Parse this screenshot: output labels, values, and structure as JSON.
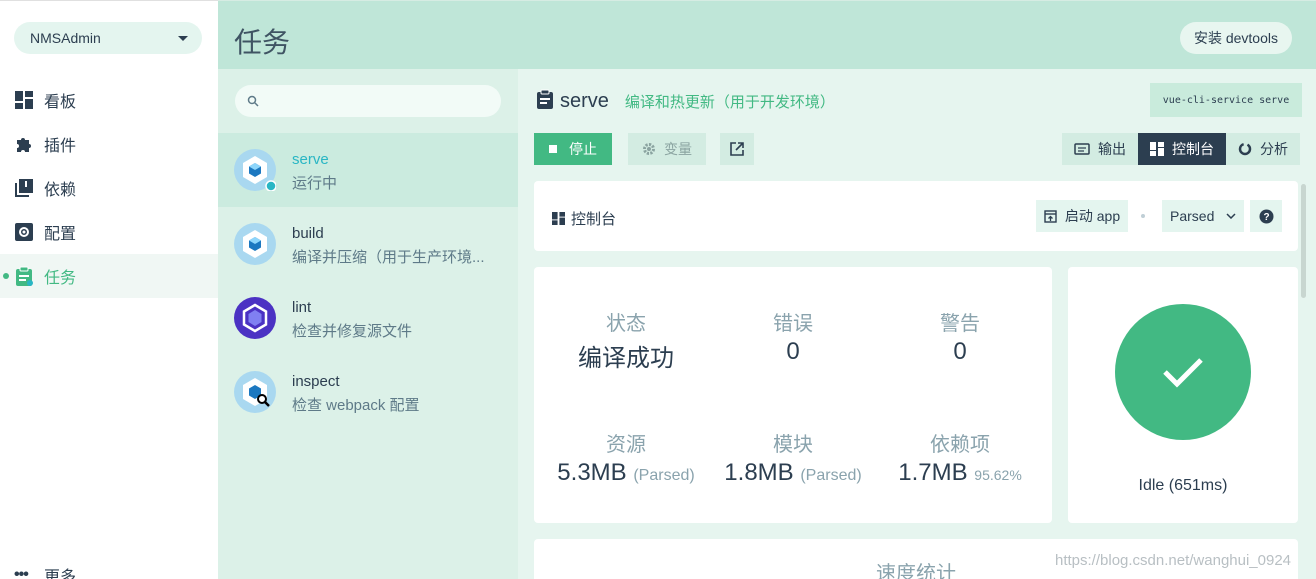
{
  "sidebar": {
    "project": "NMSAdmin",
    "items": [
      {
        "label": "看板",
        "icon": "dashboard-icon"
      },
      {
        "label": "插件",
        "icon": "puzzle-icon"
      },
      {
        "label": "依赖",
        "icon": "library-icon"
      },
      {
        "label": "配置",
        "icon": "gear-icon"
      },
      {
        "label": "任务",
        "icon": "clipboard-icon",
        "active": true
      }
    ],
    "more": "更多"
  },
  "header": {
    "title": "任务",
    "devtools_button": "安装 devtools"
  },
  "tasklist": {
    "search_placeholder": "",
    "tasks": [
      {
        "name": "serve",
        "desc": "运行中",
        "selected": true
      },
      {
        "name": "build",
        "desc": "编译并压缩（用于生产环境..."
      },
      {
        "name": "lint",
        "desc": "检查并修复源文件"
      },
      {
        "name": "inspect",
        "desc": "检查 webpack 配置"
      }
    ]
  },
  "main": {
    "task_name": "serve",
    "task_desc": "编译和热更新（用于开发环境）",
    "command": "vue-cli-service serve",
    "stop_button": "停止",
    "vars_button": "变量",
    "tabs": {
      "output": "输出",
      "console": "控制台",
      "analyze": "分析"
    },
    "dashboard": {
      "title": "控制台",
      "launch_app": "启动 app",
      "mode_select": "Parsed"
    },
    "stats": {
      "status_label": "状态",
      "status_value": "编译成功",
      "errors_label": "错误",
      "errors_value": "0",
      "warnings_label": "警告",
      "warnings_value": "0",
      "assets_label": "资源",
      "assets_value": "5.3MB",
      "assets_sub": "(Parsed)",
      "modules_label": "模块",
      "modules_value": "1.8MB",
      "modules_sub": "(Parsed)",
      "deps_label": "依赖项",
      "deps_value": "1.7MB",
      "deps_sub": "95.62%"
    },
    "status": "Idle (651ms)",
    "speed_label": "速度统计"
  },
  "watermark": "https://blog.csdn.net/wanghui_0924",
  "colors": {
    "accent": "#42b983",
    "dark": "#2c3e50",
    "header_bg": "#bfe6d8"
  }
}
